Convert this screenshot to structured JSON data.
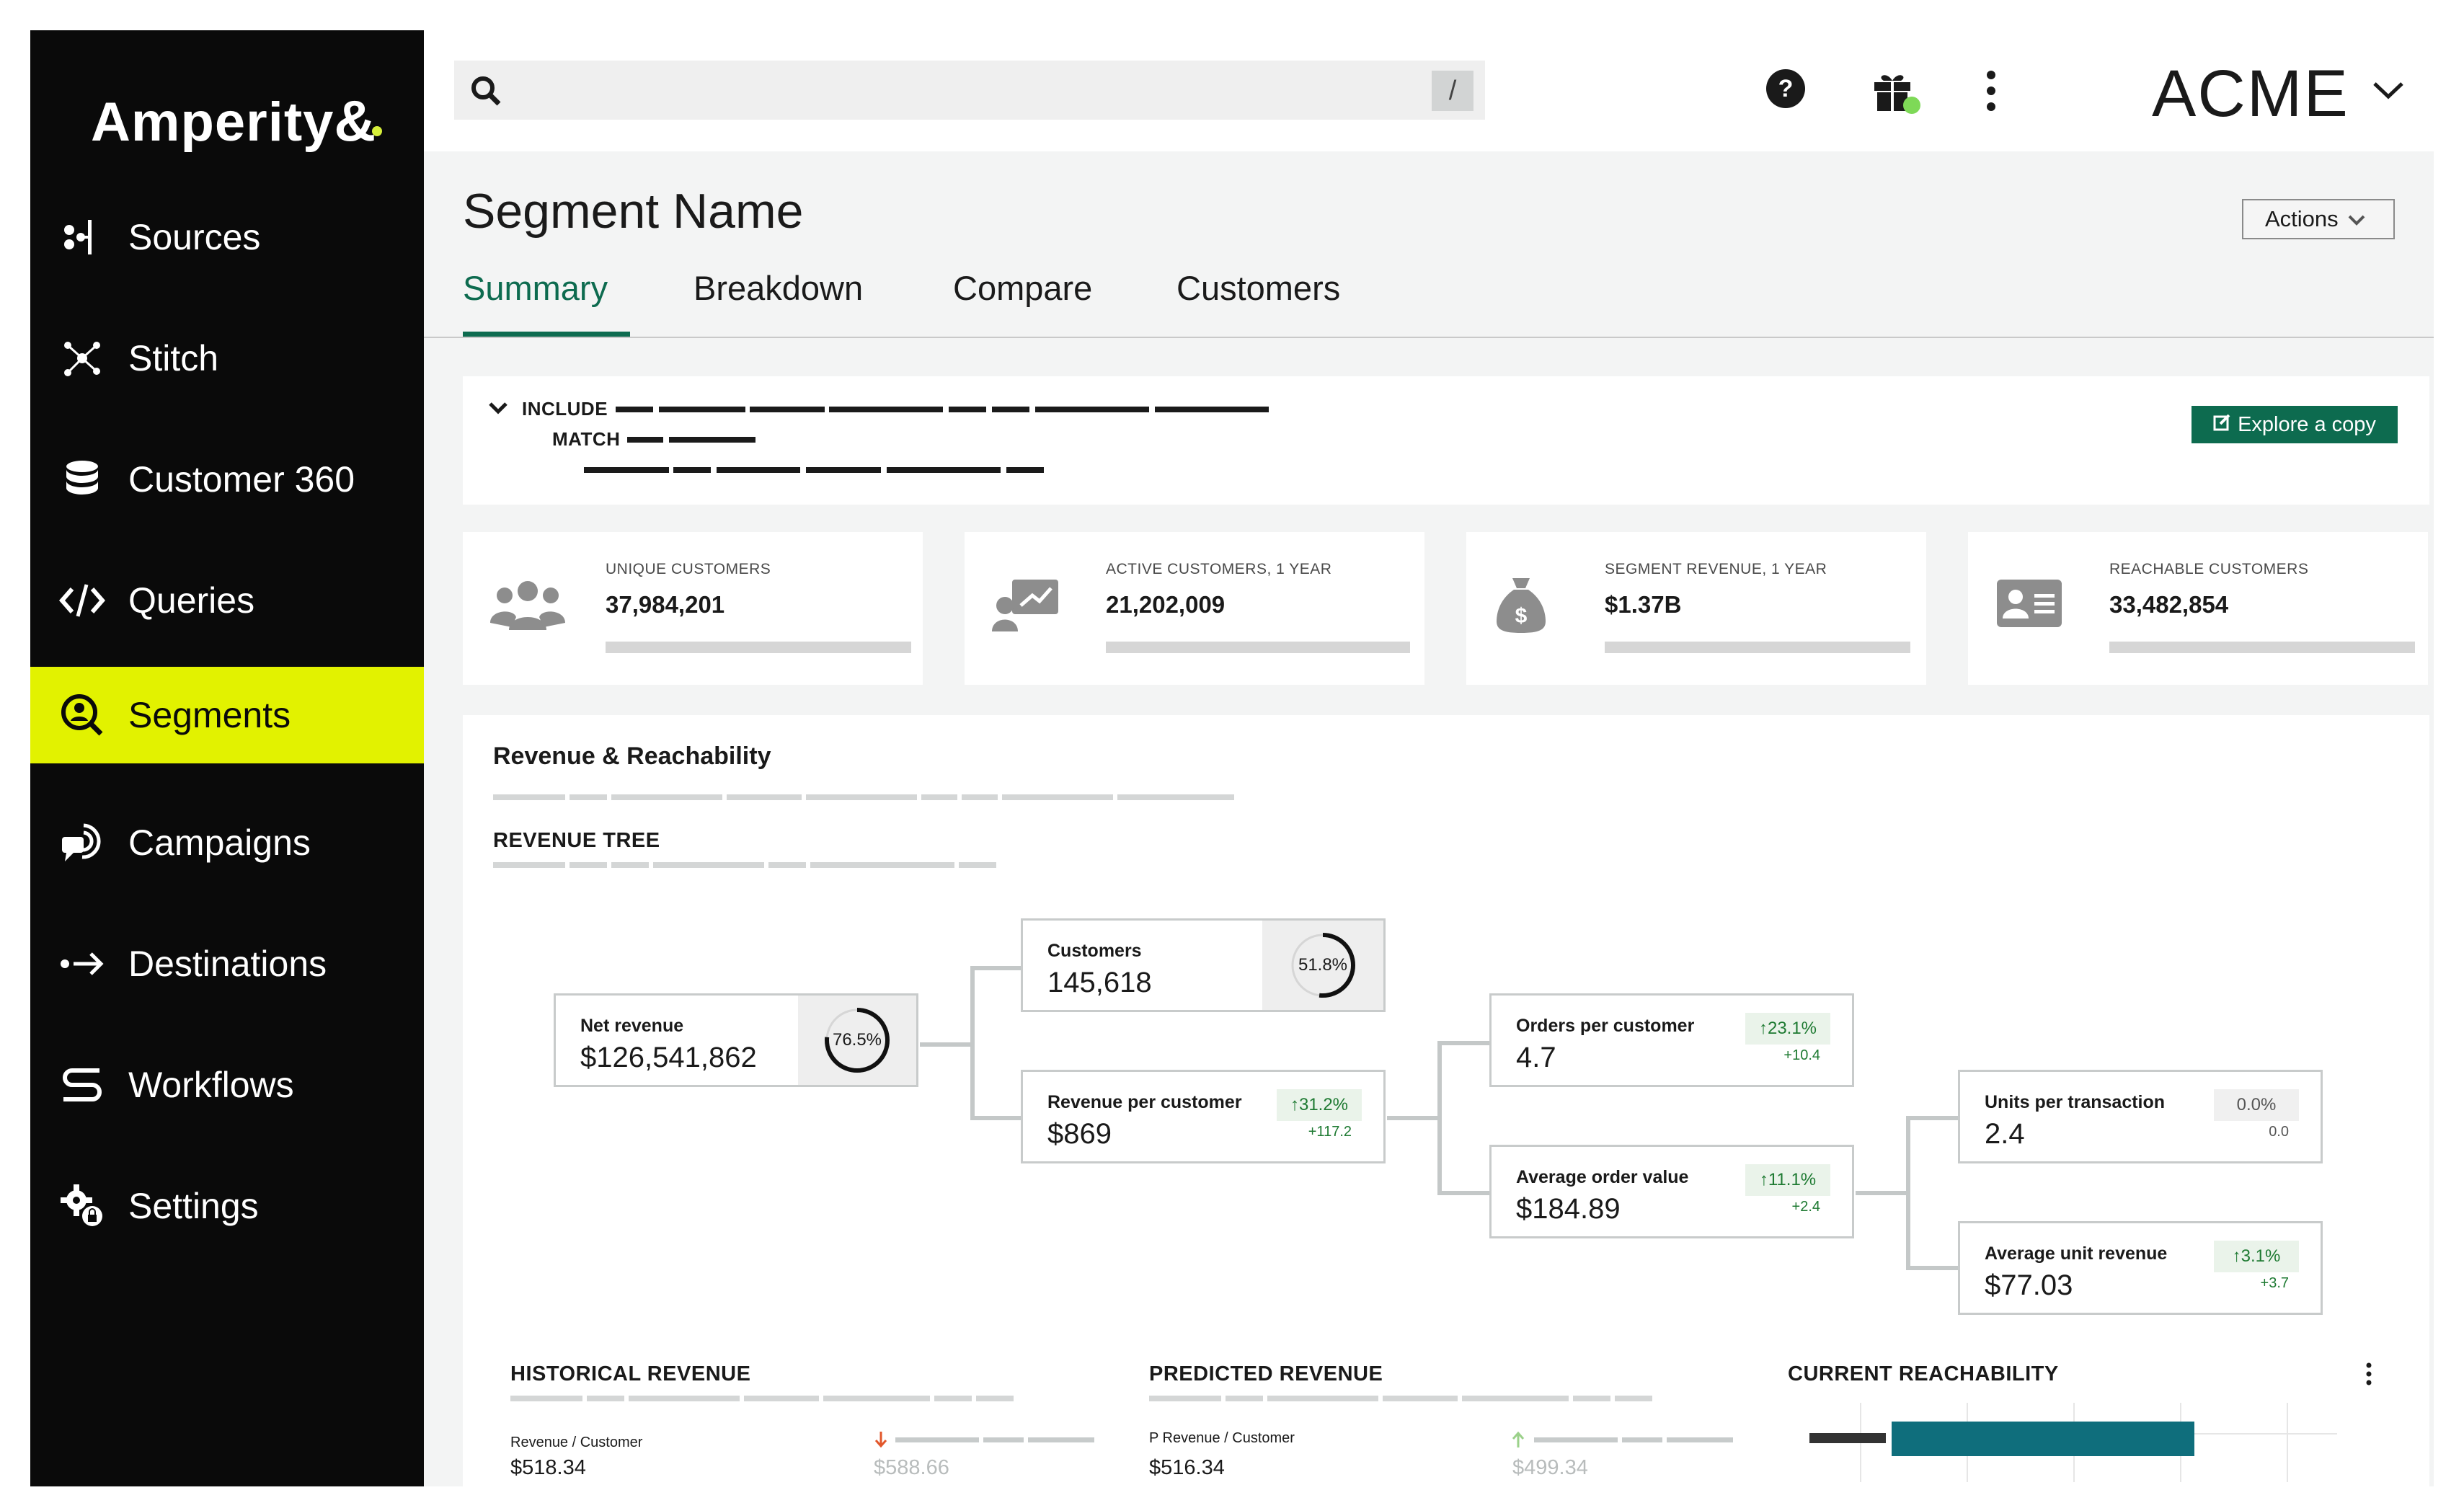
{
  "sidebar": {
    "logo": "Amperity",
    "logo_amp": "&",
    "items": [
      {
        "label": "Sources",
        "icon": "sources-icon"
      },
      {
        "label": "Stitch",
        "icon": "stitch-icon"
      },
      {
        "label": "Customer 360",
        "icon": "database-icon"
      },
      {
        "label": "Queries",
        "icon": "code-icon"
      },
      {
        "label": "Segments",
        "icon": "segments-icon",
        "active": true
      },
      {
        "label": "Campaigns",
        "icon": "campaigns-icon"
      },
      {
        "label": "Destinations",
        "icon": "destinations-icon"
      },
      {
        "label": "Workflows",
        "icon": "workflows-icon"
      },
      {
        "label": "Settings",
        "icon": "settings-icon"
      }
    ]
  },
  "topbar": {
    "search_shortcut": "/",
    "brand": "ACME"
  },
  "page": {
    "title": "Segment Name",
    "actions_label": "Actions",
    "tabs": [
      {
        "label": "Summary",
        "active": true
      },
      {
        "label": "Breakdown"
      },
      {
        "label": "Compare"
      },
      {
        "label": "Customers"
      }
    ]
  },
  "criteria": {
    "include_label": "INCLUDE",
    "match_label": "MATCH",
    "explore_label": "Explore a copy"
  },
  "kpis": [
    {
      "label": "UNIQUE CUSTOMERS",
      "value": "37,984,201",
      "icon": "users-icon"
    },
    {
      "label": "ACTIVE CUSTOMERS, 1 YEAR",
      "value": "21,202,009",
      "icon": "active-customers-icon"
    },
    {
      "label": "SEGMENT REVENUE, 1 YEAR",
      "value": "$1.37B",
      "icon": "money-bag-icon"
    },
    {
      "label": "REACHABLE CUSTOMERS",
      "value": "33,482,854",
      "icon": "contact-card-icon"
    }
  ],
  "revenue": {
    "section_title": "Revenue & Reachability",
    "tree_title": "REVENUE TREE",
    "tree": {
      "net_revenue": {
        "label": "Net revenue",
        "value": "$126,541,862",
        "pct": "76.5%",
        "fraction": 0.765
      },
      "customers": {
        "label": "Customers",
        "value": "145,618",
        "pct": "51.8%",
        "fraction": 0.518
      },
      "revenue_per_customer": {
        "label": "Revenue per customer",
        "value": "$869",
        "delta": "31.2%",
        "delta_sub": "+117.2"
      },
      "orders_per_customer": {
        "label": "Orders per customer",
        "value": "4.7",
        "delta": "23.1%",
        "delta_sub": "+10.4"
      },
      "average_order_value": {
        "label": "Average order value",
        "value": "$184.89",
        "delta": "11.1%",
        "delta_sub": "+2.4"
      },
      "units_per_transaction": {
        "label": "Units per transaction",
        "value": "2.4",
        "delta": "0.0%",
        "delta_sub": "0.0"
      },
      "average_unit_revenue": {
        "label": "Average unit revenue",
        "value": "$77.03",
        "delta": "3.1%",
        "delta_sub": "+3.7"
      }
    }
  },
  "bottom": {
    "historical": {
      "title": "HISTORICAL REVENUE",
      "metric": "Revenue / Customer",
      "value": "$518.34",
      "compare": "$588.66",
      "trend": "down"
    },
    "predicted": {
      "title": "PREDICTED REVENUE",
      "metric": "P Revenue / Customer",
      "value": "$516.34",
      "compare": "$499.34",
      "trend": "up"
    },
    "reachability": {
      "title": "CURRENT REACHABILITY"
    }
  },
  "colors": {
    "sidebar_bg": "#0a0a0a",
    "active_nav": "#e2f200",
    "accent_green": "#0d6b4f",
    "reach_bar": "#0f6e7c"
  }
}
